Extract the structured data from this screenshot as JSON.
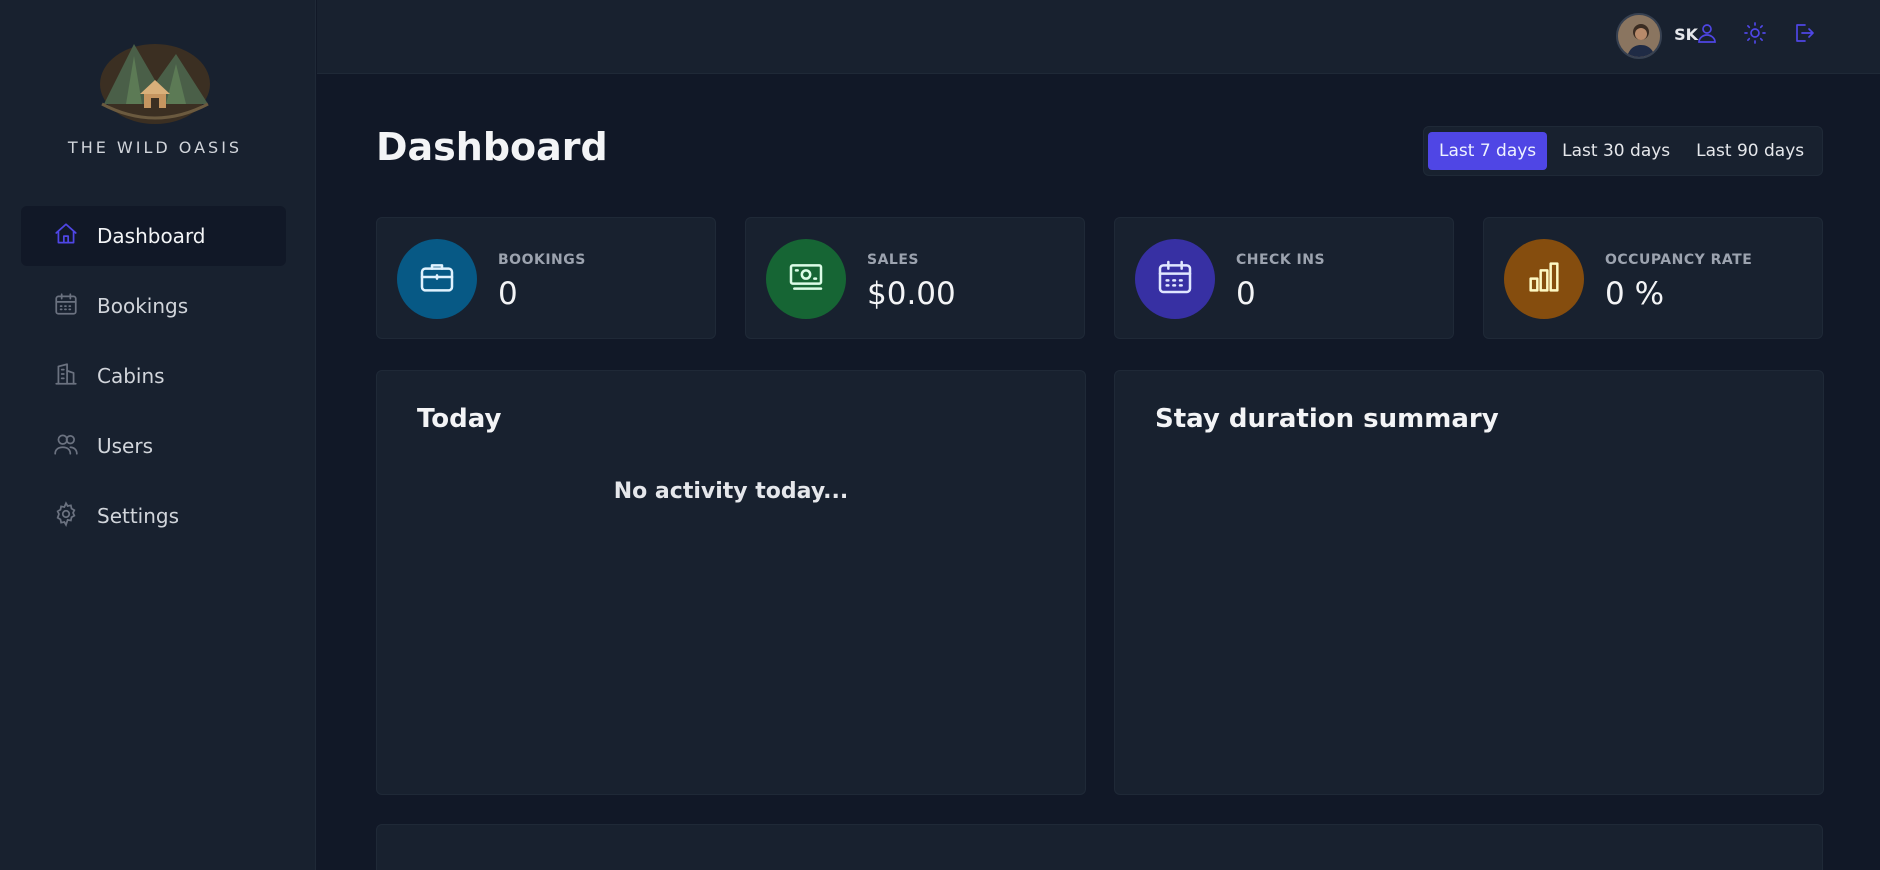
{
  "brand": {
    "name": "THE WILD OASIS"
  },
  "sidebar": {
    "items": [
      {
        "label": "Dashboard",
        "icon": "home-icon",
        "active": true
      },
      {
        "label": "Bookings",
        "icon": "calendar-icon",
        "active": false
      },
      {
        "label": "Cabins",
        "icon": "building-icon",
        "active": false
      },
      {
        "label": "Users",
        "icon": "users-icon",
        "active": false
      },
      {
        "label": "Settings",
        "icon": "gear-icon",
        "active": false
      }
    ]
  },
  "header": {
    "user_name": "SK",
    "actions": [
      "user-icon",
      "sun-icon",
      "logout-icon"
    ]
  },
  "main": {
    "title": "Dashboard",
    "filter": {
      "options": [
        "Last 7 days",
        "Last 30 days",
        "Last 90 days"
      ],
      "selected": "Last 7 days"
    },
    "stats": [
      {
        "label": "BOOKINGS",
        "value": "0",
        "icon": "briefcase-icon",
        "color": "#075985"
      },
      {
        "label": "SALES",
        "value": "$0.00",
        "icon": "banknotes-icon",
        "color": "#166534"
      },
      {
        "label": "CHECK INS",
        "value": "0",
        "icon": "calendar-days-icon",
        "color": "#3730a3"
      },
      {
        "label": "OCCUPANCY RATE",
        "value": "0 %",
        "icon": "chart-bar-icon",
        "color": "#854d0e"
      }
    ],
    "today": {
      "title": "Today",
      "empty_text": "No activity today..."
    },
    "stay_summary": {
      "title": "Stay duration summary"
    }
  },
  "colors": {
    "accent": "#4f46e5",
    "background": "#111827",
    "surface": "#18212f"
  }
}
